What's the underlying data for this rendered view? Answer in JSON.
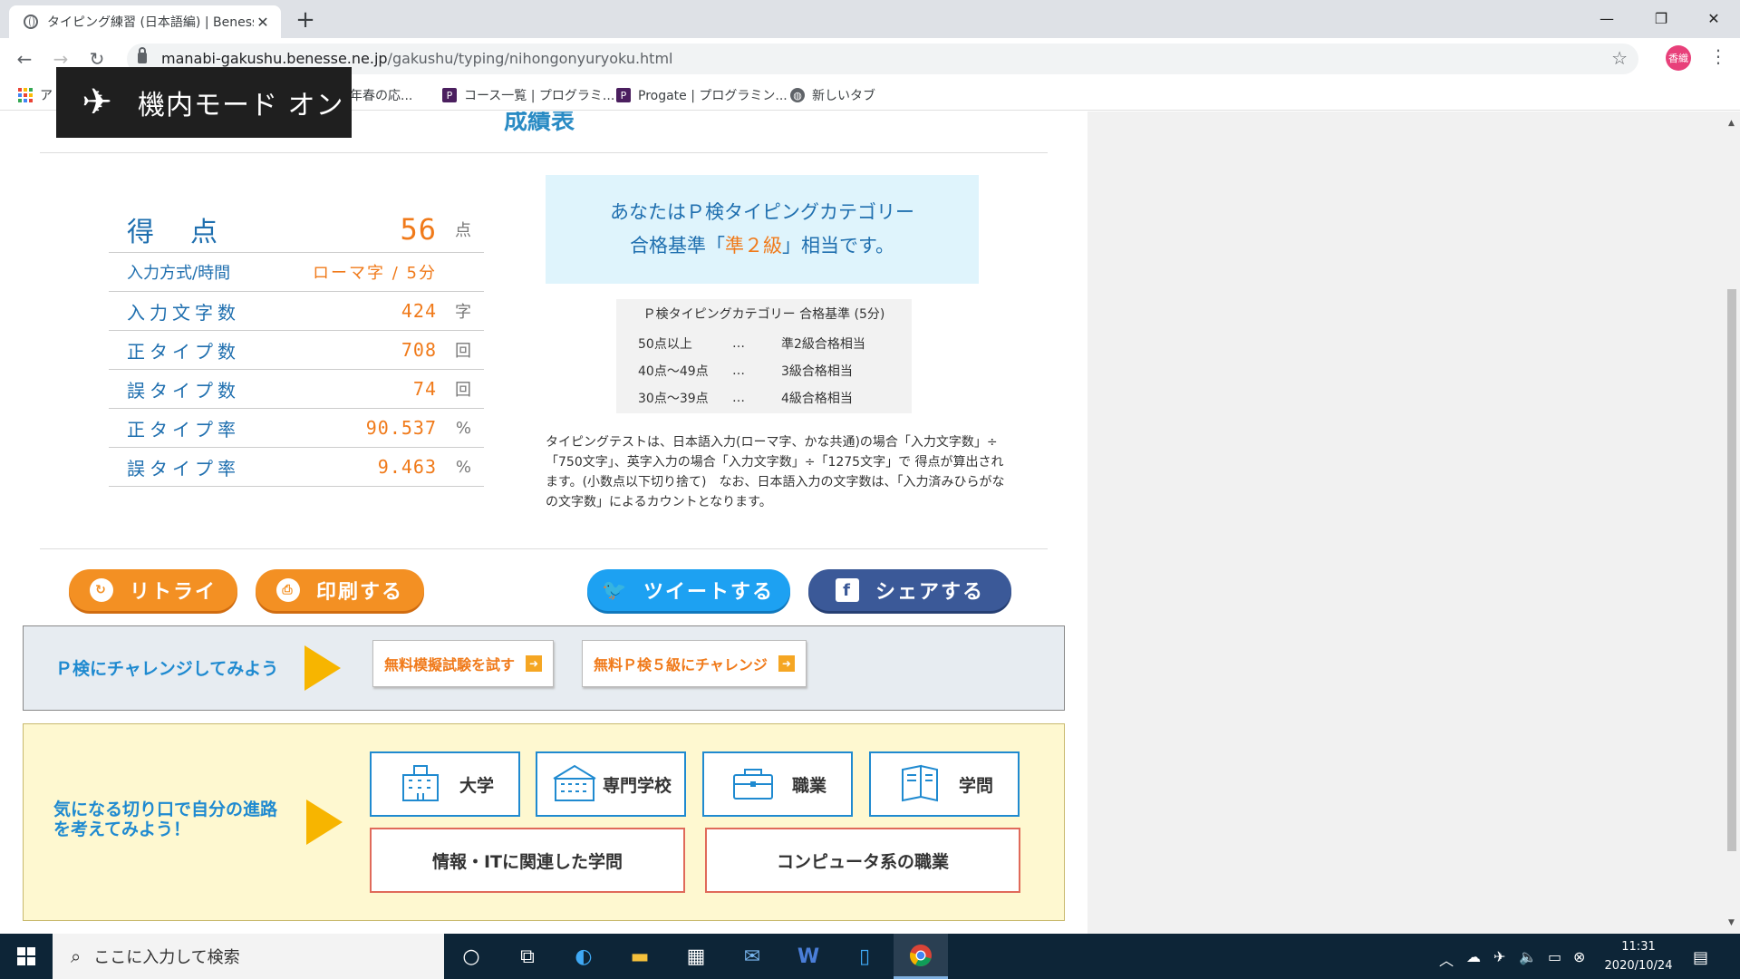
{
  "browser": {
    "tab_title": "タイピング練習 (日本語編) | Benesse",
    "url_host": "manabi-gakushu.benesse.ne.jp",
    "url_path": "/gakushu/typing/nihongonyuryoku.html",
    "profile_initials": "香織",
    "bookmarks": [
      {
        "label": "ア",
        "icon": "apps-icon"
      },
      {
        "label": "年春の応...",
        "icon": "generic-icon"
      },
      {
        "label": "コース一覧 | プログラミ...",
        "icon": "progate-icon"
      },
      {
        "label": "Progate | プログラミン...",
        "icon": "progate-icon"
      },
      {
        "label": "新しいタブ",
        "icon": "globe-icon"
      }
    ]
  },
  "airplane_toast": {
    "label": "機内モード オン"
  },
  "page": {
    "section_title": "成績表",
    "score": {
      "points_label": "得点",
      "points_value": "56",
      "points_unit": "点",
      "mode_label": "入力方式/時間",
      "mode_value": "ローマ字 / 5分",
      "rows": [
        {
          "label": "入力文字数",
          "value": "424",
          "unit": "字"
        },
        {
          "label": "正タイプ数",
          "value": "708",
          "unit": "回"
        },
        {
          "label": "誤タイプ数",
          "value": "74",
          "unit": "回"
        },
        {
          "label": "正タイプ率",
          "value": "90.537",
          "unit": "%"
        },
        {
          "label": "誤タイプ率",
          "value": "9.463",
          "unit": "%"
        }
      ]
    },
    "result": {
      "line1": "あなたはＰ検タイピングカテゴリー",
      "line2_prefix": "合格基準「",
      "grade": "準２級",
      "line2_suffix": "」相当です。"
    },
    "criteria": {
      "title": "Ｐ検タイピングカテゴリー 合格基準 (5分)",
      "rows": [
        {
          "range": "50点以上",
          "dots": "…",
          "grade": "準2級合格相当"
        },
        {
          "range": "40点～49点",
          "dots": "…",
          "grade": "3級合格相当"
        },
        {
          "range": "30点～39点",
          "dots": "…",
          "grade": "4級合格相当"
        }
      ]
    },
    "note": "タイピングテストは、日本語入力(ローマ字、かな共通)の場合「入力文字数」÷「750文字」、英字入力の場合「入力文字数」÷「1275文字」で 得点が算出されます。(小数点以下切り捨て)　なお、日本語入力の文字数は、「入力済みひらがなの文字数」によるカウントとなります。",
    "buttons": {
      "retry": "リトライ",
      "print": "印刷する",
      "tweet": "ツイートする",
      "share": "シェアする"
    },
    "challenge": {
      "text": "Ｐ検にチャレンジしてみよう",
      "btn1": "無料模擬試験を試す",
      "btn2": "無料Ｐ検５級にチャレンジ"
    },
    "career": {
      "text_line1": "気になる切り口で自分の進路",
      "text_line2": "を考えてみよう！",
      "categories": [
        "大学",
        "専門学校",
        "職業",
        "学問"
      ],
      "links": [
        "情報・ITに関連した学問",
        "コンピュータ系の職業"
      ]
    }
  },
  "taskbar": {
    "search_placeholder": "ここに入力して検索",
    "time": "11:31",
    "date": "2020/10/24"
  }
}
